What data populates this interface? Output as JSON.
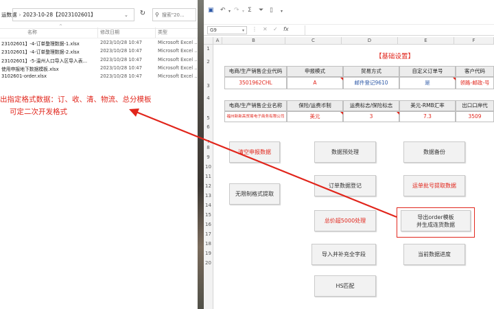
{
  "explorer": {
    "breadcrumb": [
      "运数据",
      "2023-10-28【2023102601】"
    ],
    "search_placeholder": "搜索\"20...",
    "columns": [
      "名称",
      "修改日期",
      "类型"
    ],
    "files": [
      {
        "name": "23102601】-4-订单整理数据-1.xlsx",
        "date": "2023/10/28 10:47",
        "type": "Microsoft Excel ..."
      },
      {
        "name": "23102601】-4-订单整理数据-2.xlsx",
        "date": "2023/10/28 10:47",
        "type": "Microsoft Excel ..."
      },
      {
        "name": "23102601】-5-温州人口导入区导入表...",
        "date": "2023/10/28 10:47",
        "type": "Microsoft Excel ..."
      },
      {
        "name": "使用申报地下数据模板.xlsx",
        "date": "2023/10/28 10:47",
        "type": "Microsoft Excel ..."
      },
      {
        "name": "3102601-order.xlsx",
        "date": "2023/10/28 10:47",
        "type": "Microsoft Excel ..."
      }
    ]
  },
  "annotation": {
    "line1": "出指定格式数据：订、收、清、物流、总分模板",
    "line2": "可定二次开发格式"
  },
  "excel": {
    "name_box": "G9",
    "columns": [
      "A",
      "B",
      "C",
      "D",
      "E",
      "F"
    ],
    "rows": [
      "1",
      "2",
      "3",
      "4",
      "5",
      "6",
      "7",
      "8",
      "9",
      "10",
      "11",
      "12",
      "13",
      "14",
      "15",
      "16",
      "17",
      "18",
      "19",
      "20"
    ],
    "title": "【基础设置】",
    "table1": {
      "headers": [
        "电商/生产销售企业代码",
        "申报模式",
        "贸易方式",
        "自定义订单号",
        "客户代码"
      ],
      "values": [
        "3501962CHL",
        "A",
        "邮件登记9610",
        "是",
        "领路-邮政-号"
      ]
    },
    "table2": {
      "headers": [
        "电商/生产销售企业名称",
        "保险/运费币制",
        "运费标志/保险标志",
        "美元-RMB汇率",
        "出口口岸代"
      ],
      "values": [
        "福州新新高贸易电子商务有限公司",
        "美元",
        "3",
        "7.3",
        "3509"
      ]
    },
    "buttons": {
      "clear": "清空申报数据",
      "preprocess": "数据预处理",
      "backup": "数据备份",
      "unlimited": "无限制格式提取",
      "order_register": "订单数据登记",
      "waybill_extract": "运单批号提取数据",
      "over5000": "总价超5000处理",
      "export_line1": "导出order模板",
      "export_line2": "并生成连货数据",
      "import_fill": "导入并补充全字段",
      "progress": "当前数据进度",
      "hs": "HS匹配"
    }
  },
  "colors": {
    "accent_red": "#e1251b",
    "blue_value": "#2b57a6",
    "header_gray": "#ececec"
  }
}
